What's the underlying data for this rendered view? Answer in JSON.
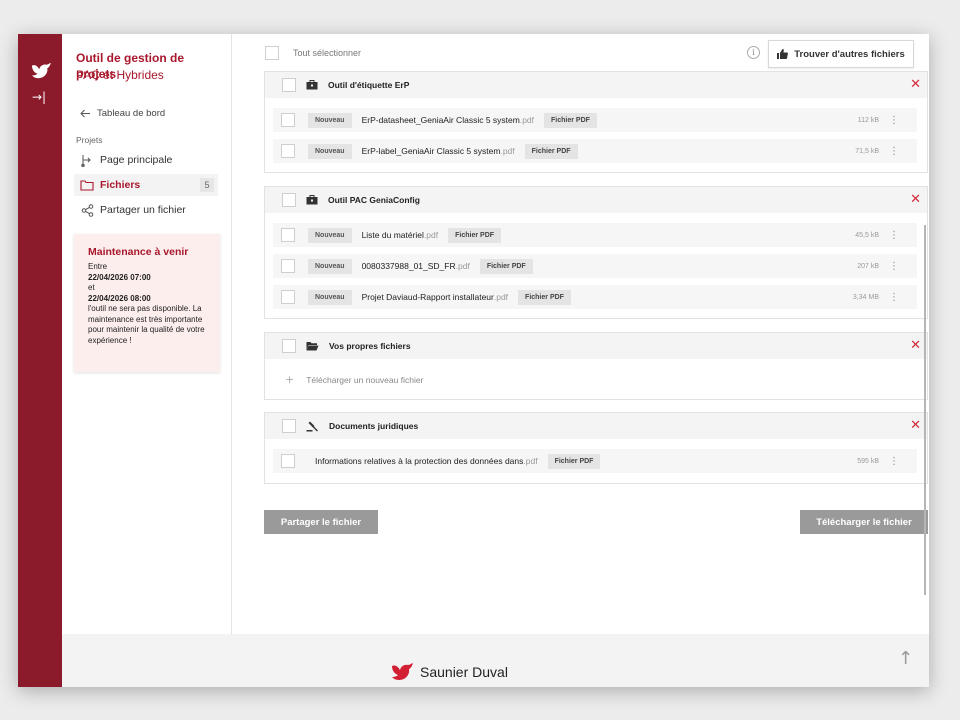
{
  "app": {
    "title": "Outil de gestion de projets",
    "subtitle": "PAC et Hybrides"
  },
  "icons": {
    "logo": "bird-logo-icon",
    "collapse": "collapse-sidebar-icon",
    "back": "arrow-left-icon",
    "main_page": "flow-icon",
    "files": "folder-icon",
    "share": "share-icon",
    "info": "info-icon",
    "thumbs_up": "thumbs-up-icon",
    "close": "close-icon",
    "kebab": "kebab-menu-icon",
    "plus": "plus-icon",
    "scroll_top": "arrow-up-icon"
  },
  "colors": {
    "brand": "#8b1a2b",
    "accent": "#a8172c",
    "close": "#d42a3a",
    "button_grey": "#9a9a9a"
  },
  "sidebar": {
    "collapse_glyph": "→|",
    "back_label": "Tableau de bord",
    "section_label": "Projets",
    "items": [
      {
        "label": "Page principale"
      },
      {
        "label": "Fichiers",
        "badge": "5",
        "active": true
      },
      {
        "label": "Partager un fichier"
      }
    ]
  },
  "maintenance": {
    "title": "Maintenance à venir",
    "line1": "Entre",
    "start": "22/04/2026 07:00",
    "line2": "et",
    "end": "22/04/2026 08:00",
    "message": "l'outil ne sera pas disponible. La maintenance est très importante pour maintenir la qualité de votre expérience !"
  },
  "toolbar": {
    "select_all": "Tout sélectionner",
    "find_button": "Trouver d'autres fichiers"
  },
  "groups": [
    {
      "title": "Outil d'étiquette ErP",
      "files": [
        {
          "tag": "Nouveau",
          "name": "ErP-datasheet_GeniaAir Classic 5 system",
          "ext": ".pdf",
          "type": "Fichier PDF",
          "size": "112 kB"
        },
        {
          "tag": "Nouveau",
          "name": "ErP-label_GeniaAir Classic 5 system",
          "ext": ".pdf",
          "type": "Fichier PDF",
          "size": "71,5 kB"
        }
      ]
    },
    {
      "title": "Outil PAC GeniaConfig",
      "files": [
        {
          "tag": "Nouveau",
          "name": "Liste du matériel",
          "ext": ".pdf",
          "type": "Fichier PDF",
          "size": "45,5 kB"
        },
        {
          "tag": "Nouveau",
          "name": "0080337988_01_SD_FR",
          "ext": ".pdf",
          "type": "Fichier PDF",
          "size": "207 kB"
        },
        {
          "tag": "Nouveau",
          "name": "Projet Daviaud-Rapport installateur",
          "ext": ".pdf",
          "type": "Fichier PDF",
          "size": "3,34 MB"
        }
      ]
    },
    {
      "title": "Vos propres fichiers",
      "upload_label": "Télécharger un nouveau fichier"
    },
    {
      "title": "Documents juridiques",
      "files": [
        {
          "name": "Informations relatives à la protection des données dans",
          "ext": ".pdf",
          "type": "Fichier PDF",
          "size": "595 kB"
        }
      ]
    }
  ],
  "actions": {
    "share": "Partager le fichier",
    "download": "Télécharger le fichier"
  },
  "footer": {
    "brand": "Saunier Duval"
  }
}
